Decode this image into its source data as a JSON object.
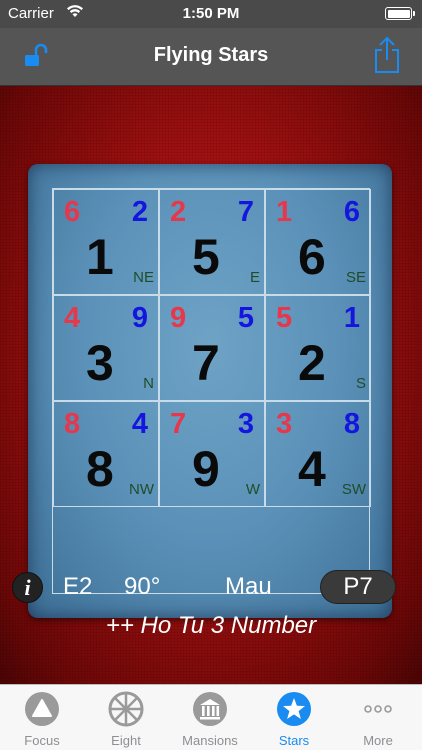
{
  "status_bar": {
    "carrier": "Carrier",
    "time": "1:50 PM"
  },
  "nav": {
    "title": "Flying Stars",
    "left_icon": "unlock-icon",
    "right_icon": "share-icon"
  },
  "grid": {
    "cells": [
      {
        "mountain": "6",
        "water": "2",
        "base": "1",
        "dir": "NE"
      },
      {
        "mountain": "2",
        "water": "7",
        "base": "5",
        "dir": "E"
      },
      {
        "mountain": "1",
        "water": "6",
        "base": "6",
        "dir": "SE"
      },
      {
        "mountain": "4",
        "water": "9",
        "base": "3",
        "dir": "N"
      },
      {
        "mountain": "9",
        "water": "5",
        "base": "7",
        "dir": ""
      },
      {
        "mountain": "5",
        "water": "1",
        "base": "2",
        "dir": "S"
      },
      {
        "mountain": "8",
        "water": "4",
        "base": "8",
        "dir": "NW"
      },
      {
        "mountain": "7",
        "water": "3",
        "base": "9",
        "dir": "W"
      },
      {
        "mountain": "3",
        "water": "8",
        "base": "4",
        "dir": "SW"
      }
    ],
    "colors": {
      "mountain": "#e8364a",
      "water": "#1515e0",
      "base": "#0a0a0a",
      "direction": "#1f4d2a"
    }
  },
  "info": {
    "code": "E2",
    "degrees": "90°",
    "animal": "Mau",
    "period": "P7",
    "formula": "++ Ho Tu 3 Number"
  },
  "tabs": [
    {
      "label": "Focus",
      "icon": "triangle-icon"
    },
    {
      "label": "Eight",
      "icon": "wheel-icon"
    },
    {
      "label": "Mansions",
      "icon": "temple-icon"
    },
    {
      "label": "Stars",
      "icon": "star-icon",
      "active": true
    },
    {
      "label": "More",
      "icon": "more-icon"
    }
  ],
  "accent": "#1a8bf0"
}
